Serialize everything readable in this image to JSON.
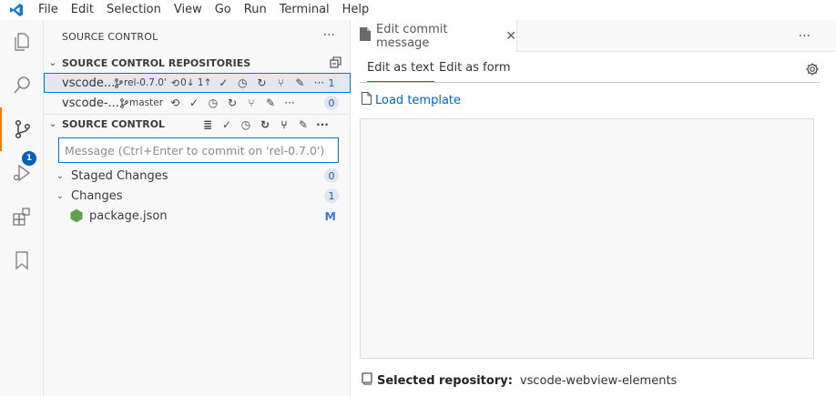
{
  "menubar": {
    "items": [
      "File",
      "Edit",
      "Selection",
      "View",
      "Go",
      "Run",
      "Terminal",
      "Help"
    ]
  },
  "activitybar": {
    "items": [
      "explorer-icon",
      "search-icon",
      "source-control-icon",
      "run-debug-icon",
      "extensions-icon",
      "bookmark-icon"
    ],
    "source_control_badge": "1",
    "accent": "#f57c00"
  },
  "sidebar": {
    "title": "SOURCE CONTROL",
    "repositories": {
      "header": "SOURCE CONTROL REPOSITORIES",
      "repos": [
        {
          "name": "vscode...",
          "branch": "rel-0.7.0'",
          "sync": "0↓ 1↑",
          "count": "1"
        },
        {
          "name": "vscode-...",
          "branch": "master",
          "count": "0"
        }
      ]
    },
    "source_control": {
      "header": "SOURCE CONTROL",
      "message_placeholder": "Message (Ctrl+Enter to commit on 'rel-0.7.0')",
      "staged": {
        "label": "Staged Changes",
        "count": "0"
      },
      "changes": {
        "label": "Changes",
        "count": "1"
      },
      "files": [
        {
          "name": "package.json",
          "status": "M"
        }
      ]
    }
  },
  "editor": {
    "tab": {
      "label": "Edit commit message"
    },
    "subtabs": {
      "text": "Edit as text",
      "form": "Edit as form"
    },
    "load_template": "Load template",
    "selected_repo": {
      "label": "Selected repository:",
      "value": "vscode-webview-elements"
    }
  },
  "colors": {
    "accent_blue": "#0078d4",
    "badge_blue": "#005fb8",
    "link_blue": "#0066bf",
    "node_green": "#5fa04e"
  }
}
